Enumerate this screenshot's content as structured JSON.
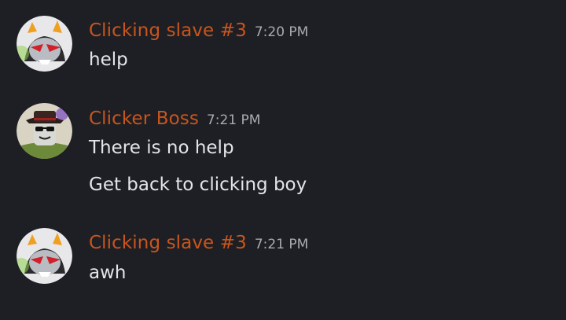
{
  "messages": [
    {
      "author": "Clicking slave #3",
      "time": "7:20 PM",
      "avatar": "troll-avatar-icon",
      "lines": [
        "help"
      ]
    },
    {
      "author": "Clicker Boss",
      "time": "7:21 PM",
      "avatar": "boss-avatar-icon",
      "lines": [
        "There is no help",
        "Get back to clicking boy"
      ]
    },
    {
      "author": "Clicking slave #3",
      "time": "7:21 PM",
      "avatar": "troll-avatar-icon",
      "lines": [
        "awh"
      ]
    }
  ],
  "colors": {
    "background": "#1e1f24",
    "username": "#c8551d",
    "timestamp": "#a9abb3",
    "text": "#e4e5e8"
  }
}
